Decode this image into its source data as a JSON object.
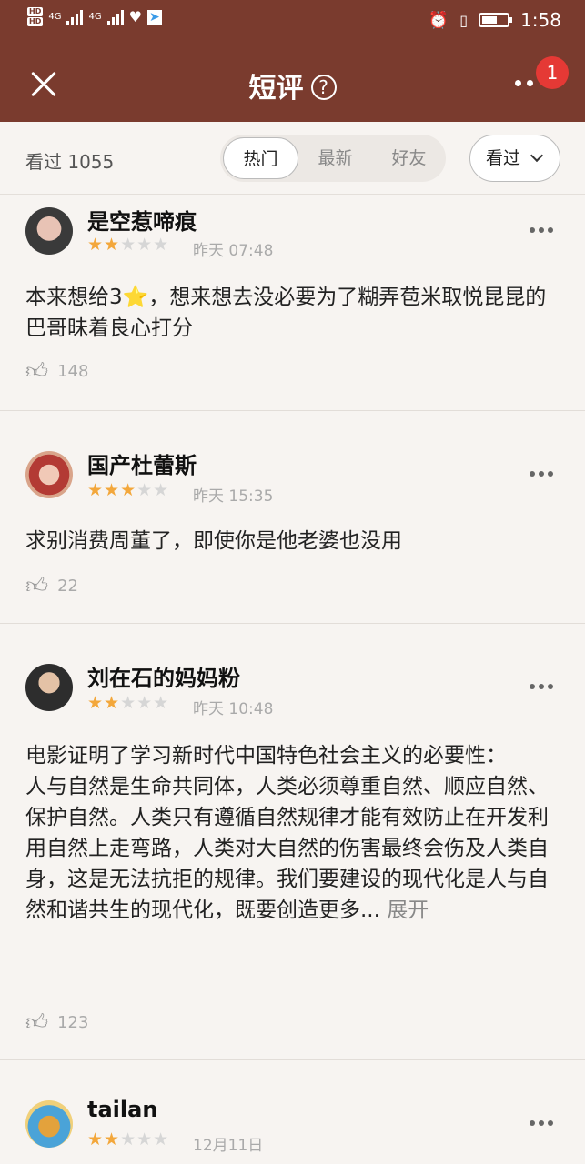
{
  "status_bar": {
    "hd1": "HD",
    "hd2": "HD",
    "net1": "4G",
    "net2": "4G",
    "time": "1:58"
  },
  "header": {
    "title": "短评",
    "help_icon": "help-circle-icon",
    "badge": "1"
  },
  "filter": {
    "seen_count": "看过 1055",
    "tabs": [
      "热门",
      "最新",
      "好友"
    ],
    "active_tab": "热门",
    "dropdown_label": "看过"
  },
  "colors": {
    "header_bg": "#7a3b2e",
    "star_on": "#f3a73b",
    "star_off": "#d6d6d6",
    "badge": "#e53935"
  },
  "reviews": [
    {
      "user": "是空惹啼痕",
      "rating": 2,
      "date": "昨天 07:48",
      "text": "本来想给3⭐，想来想去没必要为了糊弄苞米取悦昆昆的巴哥昧着良心打分",
      "likes": "148"
    },
    {
      "user": "国产杜蕾斯",
      "rating": 3,
      "date": "昨天 15:35",
      "text": "求别消费周董了，即使你是他老婆也没用",
      "likes": "22"
    },
    {
      "user": "刘在石的妈妈粉",
      "rating": 2,
      "date": "昨天 10:48",
      "text": "电影证明了学习新时代中国特色社会主义的必要性：\n人与自然是生命共同体，人类必须尊重自然、顺应自然、保护自然。人类只有遵循自然规律才能有效防止在开发利用自然上走弯路，人类对大自然的伤害最终会伤及人类自身，这是无法抗拒的规律。我们要建设的现代化是人与自然和谐共生的现代化，既要创造更多...",
      "expand": "展开",
      "likes": "123"
    },
    {
      "user": "tailan",
      "rating": 2,
      "date": "12月11日"
    }
  ]
}
